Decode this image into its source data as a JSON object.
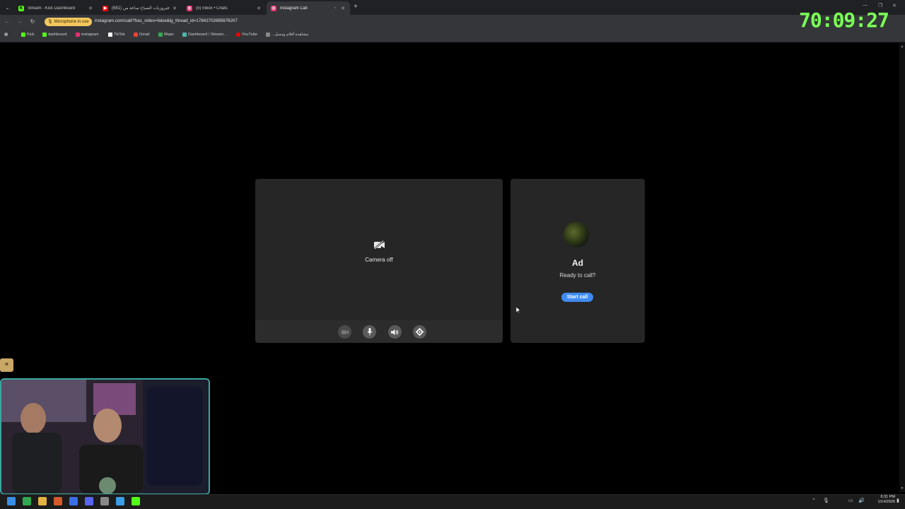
{
  "browser": {
    "tabs": [
      {
        "title": "Stream - Kick Dashboard",
        "favicon": "kick-icon",
        "color": "#53fc18",
        "active": false
      },
      {
        "title": "(681) فيروزيات الصباح ساعة من",
        "favicon": "youtube-icon",
        "color": "#ff0000",
        "active": false
      },
      {
        "title": "(9) Inbox • Chats",
        "favicon": "instagram-icon",
        "color": "#e1306c",
        "active": false
      },
      {
        "title": "Instagram Call",
        "favicon": "instagram-icon",
        "color": "#e1306c",
        "active": true
      }
    ],
    "mic_indicator": "Microphone in use",
    "url": "instagram.com/call/?has_video=false&ig_thread_id=17842702695676207",
    "bookmarks": [
      {
        "label": "Kick",
        "color": "#53fc18"
      },
      {
        "label": "dashboard",
        "color": "#53fc18"
      },
      {
        "label": "instagram",
        "color": "#e1306c"
      },
      {
        "label": "TikTok",
        "color": "#ffffff"
      },
      {
        "label": "Gmail",
        "color": "#ea4335"
      },
      {
        "label": "Maps",
        "color": "#34a853"
      },
      {
        "label": "Dashboard / Stream...",
        "color": "#4db6ac"
      },
      {
        "label": "YouTube",
        "color": "#ff0000"
      },
      {
        "label": "...مشاهدة أفلام ومسل",
        "color": "#888888"
      }
    ]
  },
  "overlay_timer": "70:09:27",
  "call": {
    "camera_status": "Camera off",
    "peer_name": "Ad",
    "peer_status": "Ready to call?",
    "start_button": "Start call"
  },
  "colors": {
    "accent": "#3f8bf2",
    "timer": "#7cff5a",
    "panel": "#262626"
  },
  "taskbar": {
    "time": "6:31 PM",
    "date": "1/14/2026"
  }
}
